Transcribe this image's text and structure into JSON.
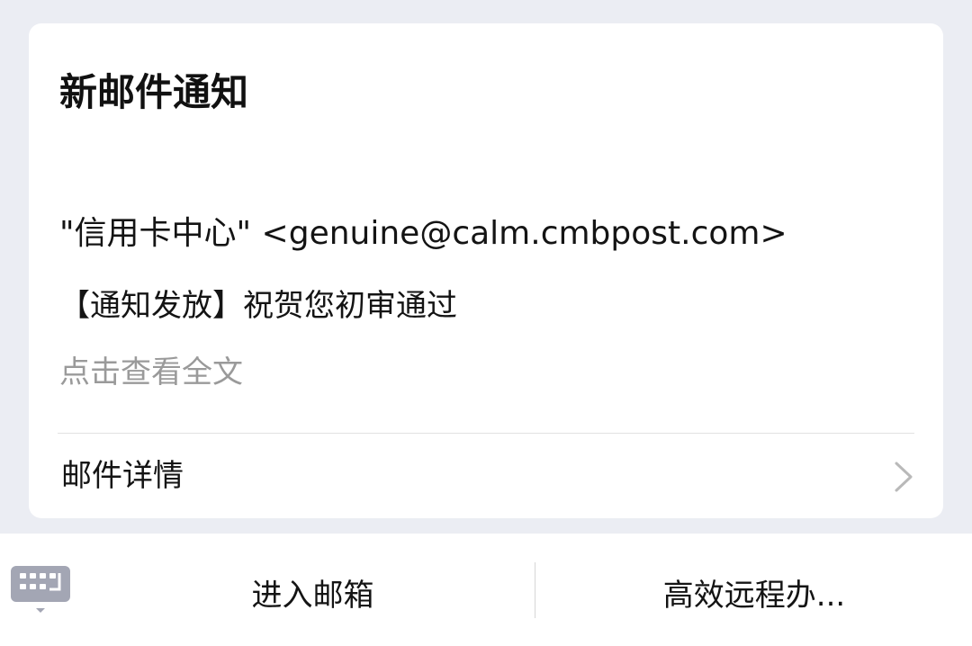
{
  "card": {
    "title": "新邮件通知",
    "sender": "\"信用卡中心\" <genuine@calm.cmbpost.com>",
    "subject": "【通知发放】祝贺您初审通过",
    "view_full": "点击查看全文",
    "details_label": "邮件详情"
  },
  "bottom_bar": {
    "keyboard_icon": "keyboard-icon",
    "left_button": "进入邮箱",
    "right_button": "高效远程办..."
  },
  "colors": {
    "background": "#ebedf3",
    "card": "#ffffff",
    "muted_text": "#9a9a9a",
    "icon_gray": "#a3a6b4"
  }
}
